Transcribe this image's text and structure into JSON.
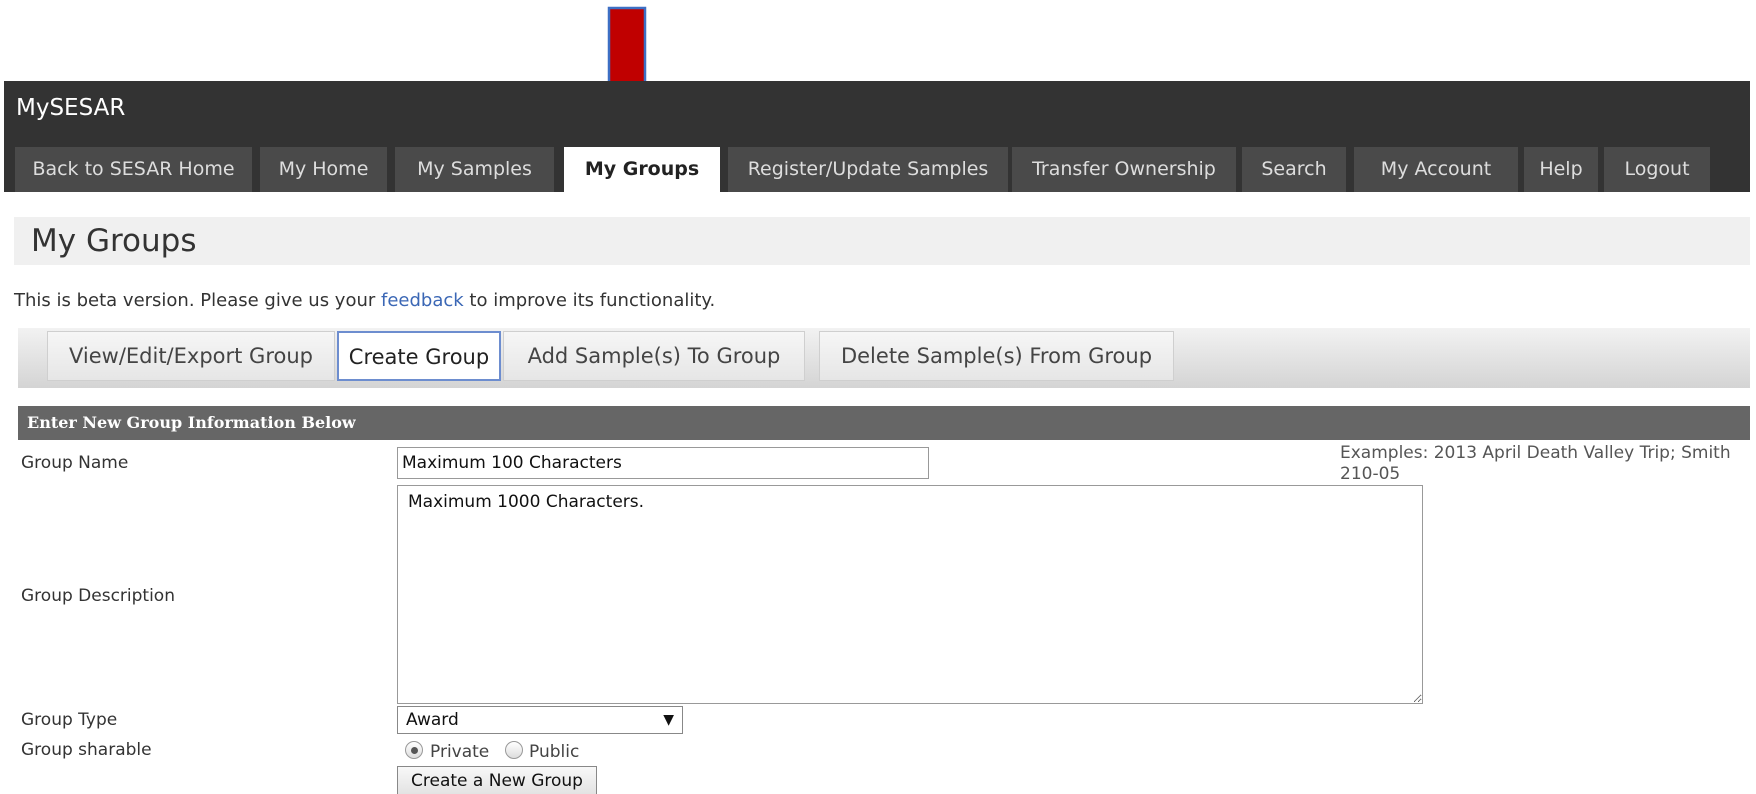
{
  "header": {
    "brand": "MySESAR",
    "nav": [
      {
        "label": "Back to SESAR Home"
      },
      {
        "label": "My Home"
      },
      {
        "label": "My Samples"
      },
      {
        "label": "My Groups",
        "active": true
      },
      {
        "label": "Register/Update Samples"
      },
      {
        "label": "Transfer Ownership"
      },
      {
        "label": "Search"
      },
      {
        "label": "My Account"
      },
      {
        "label": "Help"
      },
      {
        "label": "Logout"
      }
    ]
  },
  "page": {
    "title": "My Groups",
    "beta_prefix": "This is beta version. Please give us your ",
    "beta_link": "feedback",
    "beta_suffix": " to improve its functionality."
  },
  "subtabs": [
    {
      "label": "View/Edit/Export Group"
    },
    {
      "label": "Create Group",
      "active": true
    },
    {
      "label": "Add Sample(s) To Group"
    },
    {
      "label": "Delete Sample(s) From Group"
    }
  ],
  "form": {
    "heading": "Enter New Group Information Below",
    "name_label": "Group Name",
    "name_value": "Maximum 100 Characters",
    "name_hint": "Examples: 2013 April Death Valley Trip; Smith 210-05",
    "description_label": "Group Description",
    "description_value": "Maximum 1000 Characters.",
    "type_label": "Group Type",
    "type_value": "Award",
    "sharable_label": "Group sharable",
    "sharable_options": [
      "Private",
      "Public"
    ],
    "sharable_selected": "Private",
    "submit_label": "Create a New Group"
  },
  "colors": {
    "header_bg": "#333333",
    "tab_bg": "#4a4a4a",
    "panel_head_bg": "#666666",
    "link": "#3b67b5",
    "arrow": "#c00000",
    "arrow_outline": "#3d6fc4"
  }
}
